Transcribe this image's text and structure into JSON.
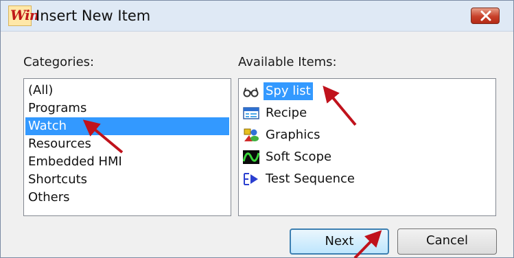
{
  "window": {
    "title": "Insert New Item",
    "app_icon_text": "Win"
  },
  "categories": {
    "label": "Categories:",
    "items": [
      "(All)",
      "Programs",
      "Watch",
      "Resources",
      "Embedded HMI",
      "Shortcuts",
      "Others"
    ],
    "selected": "Watch"
  },
  "available": {
    "label": "Available Items:",
    "items": [
      {
        "label": "Spy list",
        "icon": "glasses-icon",
        "selected": true
      },
      {
        "label": "Recipe",
        "icon": "recipe-table-icon"
      },
      {
        "label": "Graphics",
        "icon": "graphics-icon"
      },
      {
        "label": "Soft Scope",
        "icon": "scope-wave-icon"
      },
      {
        "label": "Test Sequence",
        "icon": "test-sequence-icon"
      }
    ]
  },
  "buttons": {
    "next": "Next",
    "cancel": "Cancel"
  },
  "colors": {
    "selection": "#3399ff",
    "annotation_arrow": "#c0121c",
    "titlebar": "#dfe9f5",
    "close_button": "#c8402a"
  }
}
